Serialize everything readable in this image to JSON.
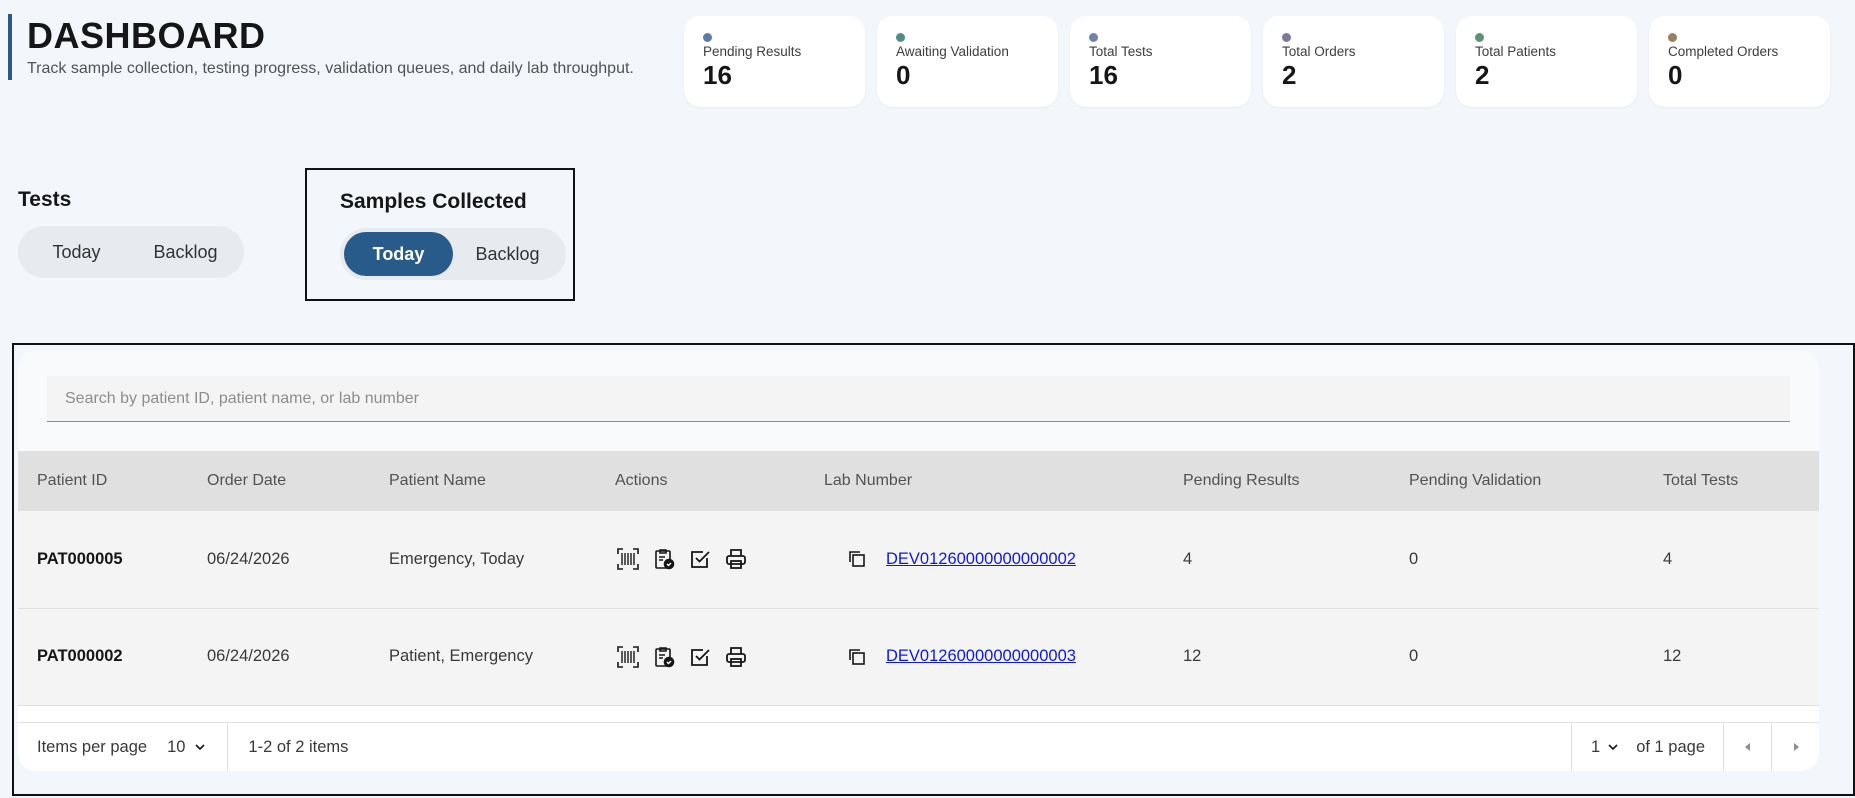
{
  "header": {
    "title": "DASHBOARD",
    "subtitle": "Track sample collection, testing progress, validation queues, and daily lab throughput.",
    "accent_color": "#2b5a8a"
  },
  "stats": [
    {
      "label": "Pending Results",
      "value": "16",
      "dot_color": "#5a7aa8"
    },
    {
      "label": "Awaiting Validation",
      "value": "0",
      "dot_color": "#4f8c86"
    },
    {
      "label": "Total Tests",
      "value": "16",
      "dot_color": "#6f84a8"
    },
    {
      "label": "Total Orders",
      "value": "2",
      "dot_color": "#7c7a98"
    },
    {
      "label": "Total Patients",
      "value": "2",
      "dot_color": "#5c9276"
    },
    {
      "label": "Completed Orders",
      "value": "0",
      "dot_color": "#9a7f62"
    }
  ],
  "tests_toggle": {
    "title": "Tests",
    "options": [
      "Today",
      "Backlog"
    ],
    "active": "none"
  },
  "samples_toggle": {
    "title": "Samples Collected",
    "options": [
      "Today",
      "Backlog"
    ],
    "active": "Today",
    "active_color": "#285a8a"
  },
  "search": {
    "placeholder": "Search by patient ID, patient name, or lab number",
    "value": ""
  },
  "table": {
    "columns": [
      "Patient ID",
      "Order Date",
      "Patient Name",
      "Actions",
      "Lab Number",
      "Pending Results",
      "Pending Validation",
      "Total Tests"
    ],
    "rows": [
      {
        "patient_id": "PAT000005",
        "order_date": "06/24/2026",
        "patient_name": "Emergency, Today",
        "lab_number": "DEV01260000000000002",
        "pending_results": "4",
        "pending_validation": "0",
        "total_tests": "4"
      },
      {
        "patient_id": "PAT000002",
        "order_date": "06/24/2026",
        "patient_name": "Patient, Emergency",
        "lab_number": "DEV01260000000000003",
        "pending_results": "12",
        "pending_validation": "0",
        "total_tests": "12"
      }
    ],
    "action_icons": [
      "barcode-icon",
      "clipboard-check-icon",
      "checkbox-icon",
      "printer-icon"
    ],
    "link_color": "#0f1ad6"
  },
  "pagination": {
    "items_per_page_label": "Items per page",
    "items_per_page": "10",
    "range_text": "1-2 of 2 items",
    "current_page": "1",
    "of_pages_text": "of 1 page"
  }
}
